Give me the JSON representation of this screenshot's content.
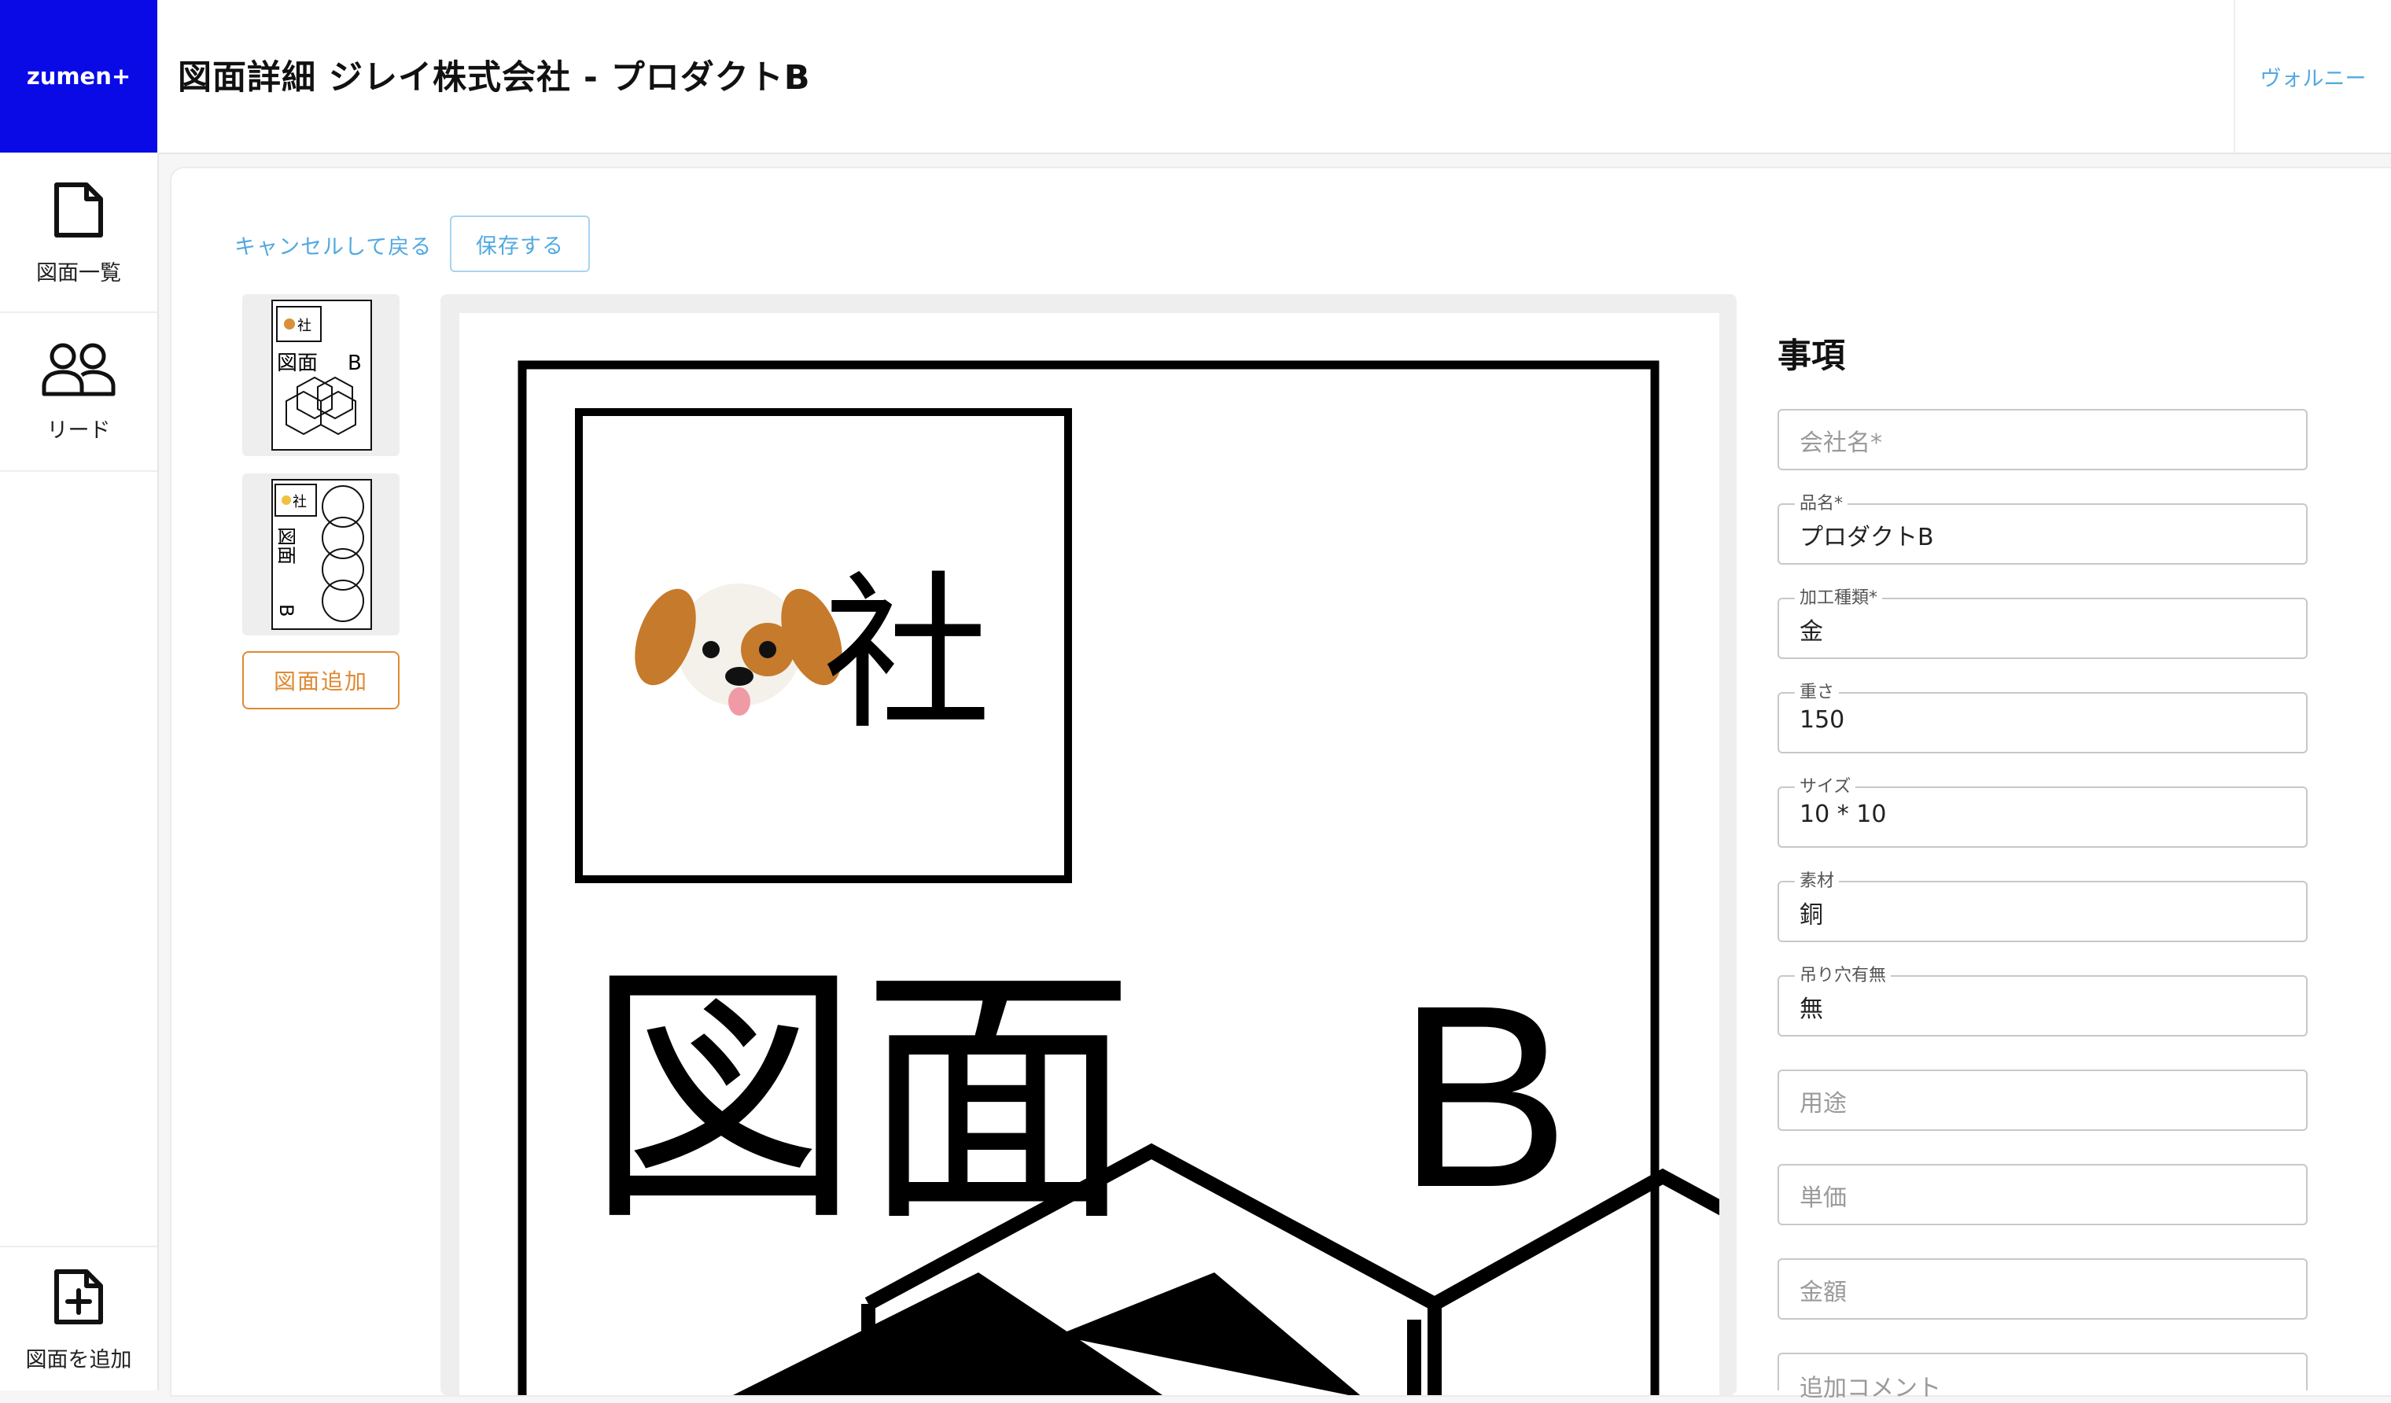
{
  "app": {
    "logo_text": "zumen+"
  },
  "header": {
    "title": "図面詳細 ジレイ株式会社 - プロダクトB",
    "user_name": "ヴォルニー"
  },
  "sidebar": {
    "items": [
      {
        "label": "図面一覧",
        "icon": "document-icon"
      },
      {
        "label": "リード",
        "icon": "users-icon"
      },
      {
        "label": "図面を追加",
        "icon": "add-document-icon"
      }
    ]
  },
  "toolbar": {
    "cancel_label": "キャンセルして戻る",
    "save_label": "保存する"
  },
  "thumbnails": {
    "items": [
      {
        "text_1": "社",
        "text_2": "図面",
        "text_3": "B"
      },
      {
        "text_1": "社",
        "text_2": "図面",
        "text_3": "B"
      }
    ],
    "add_label": "図面追加"
  },
  "preview": {
    "text_company": "社",
    "text_title": "図面",
    "text_letter": "B"
  },
  "details": {
    "title": "事項",
    "fields": [
      {
        "label": "会社名*",
        "value": "",
        "placeholder": "会社名*"
      },
      {
        "label": "品名*",
        "value": "プロダクトB"
      },
      {
        "label": "加工種類*",
        "value": "金"
      },
      {
        "label": "重さ",
        "value": "150"
      },
      {
        "label": "サイズ",
        "value": "10 * 10"
      },
      {
        "label": "素材",
        "value": "銅"
      },
      {
        "label": "吊り穴有無",
        "value": "無"
      },
      {
        "label": "用途",
        "value": "",
        "placeholder": "用途"
      },
      {
        "label": "単価",
        "value": "",
        "placeholder": "単価"
      },
      {
        "label": "金額",
        "value": "",
        "placeholder": "金額"
      },
      {
        "label": "追加コメント",
        "value": "",
        "placeholder": "追加コメント"
      }
    ]
  },
  "colors": {
    "brand": "#0a0ae6",
    "link": "#52a9e0",
    "accent_orange": "#e08a33"
  }
}
